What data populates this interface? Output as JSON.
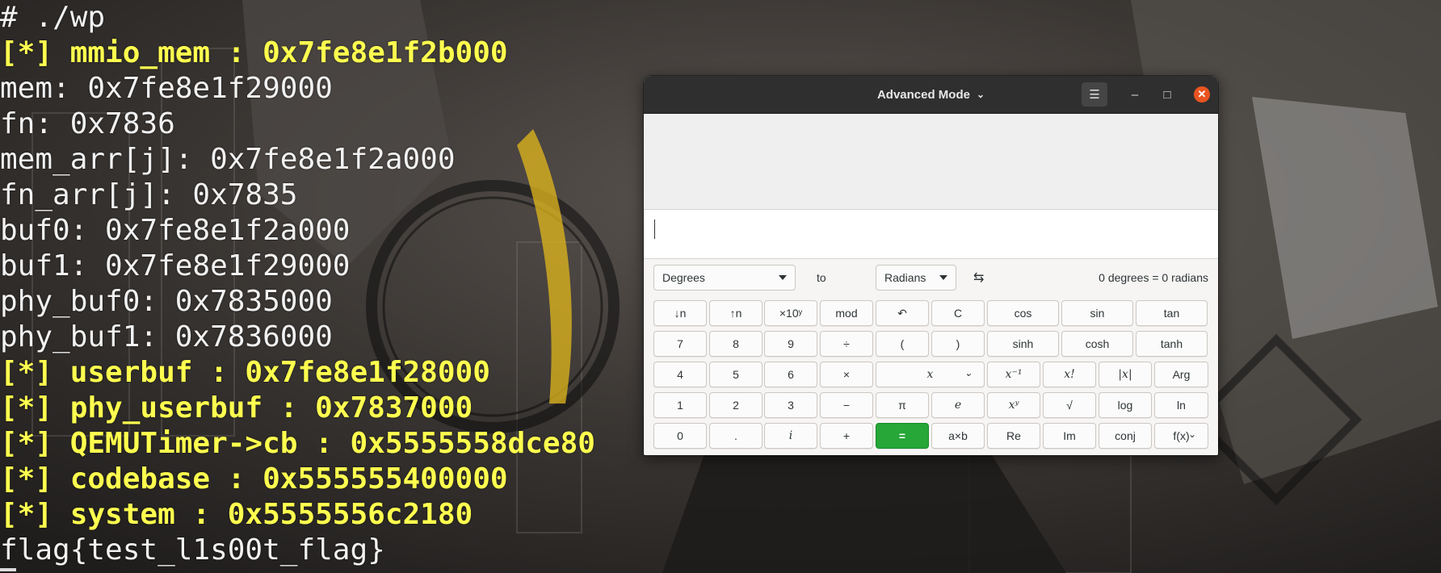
{
  "terminal": {
    "lines": [
      {
        "text": "# ./wp",
        "highlight": false
      },
      {
        "text": "[*] mmio_mem : 0x7fe8e1f2b000",
        "highlight": true
      },
      {
        "text": "mem: 0x7fe8e1f29000",
        "highlight": false
      },
      {
        "text": "fn: 0x7836",
        "highlight": false
      },
      {
        "text": "mem_arr[j]: 0x7fe8e1f2a000",
        "highlight": false
      },
      {
        "text": "fn_arr[j]: 0x7835",
        "highlight": false
      },
      {
        "text": "buf0: 0x7fe8e1f2a000",
        "highlight": false
      },
      {
        "text": "buf1: 0x7fe8e1f29000",
        "highlight": false
      },
      {
        "text": "phy_buf0: 0x7835000",
        "highlight": false
      },
      {
        "text": "phy_buf1: 0x7836000",
        "highlight": false
      },
      {
        "text": "[*] userbuf : 0x7fe8e1f28000",
        "highlight": true
      },
      {
        "text": "[*] phy_userbuf : 0x7837000",
        "highlight": true
      },
      {
        "text": "[*] QEMUTimer->cb : 0x5555558dce80",
        "highlight": true
      },
      {
        "text": "[*] codebase : 0x555555400000",
        "highlight": true
      },
      {
        "text": "[*] system : 0x5555556c2180",
        "highlight": true
      },
      {
        "text": "flag{test_l1s00t_flag}",
        "highlight": false
      }
    ],
    "text_color": "#f2f2f2",
    "highlight_color": "#ffff4f"
  },
  "calculator": {
    "title": "Advanced Mode",
    "title_chevron": "⌄",
    "menu_icon": "☰",
    "minimize_icon": "–",
    "maximize_icon": "□",
    "close_icon": "✕",
    "conversion": {
      "from_unit": "Degrees",
      "to_label": "to",
      "to_unit": "Radians",
      "swap_icon": "⇆",
      "result": "0 degrees  =  0 radians"
    },
    "keys": [
      [
        "↓n",
        "↑n",
        "×10ʸ",
        "mod",
        "↶",
        "C",
        "cos",
        "sin",
        "tan"
      ],
      [
        "7",
        "8",
        "9",
        "÷",
        "(",
        ")",
        "sinh",
        "cosh",
        "tanh"
      ],
      [
        "4",
        "5",
        "6",
        "×",
        "x",
        "x⁻¹",
        "x!",
        "|x|",
        "Arg"
      ],
      [
        "1",
        "2",
        "3",
        "−",
        "π",
        "e",
        "xʸ",
        "√",
        "log",
        "ln"
      ],
      [
        "0",
        ".",
        "i",
        "+",
        "=",
        "a×b",
        "Re",
        "Im",
        "conj",
        "f(x)"
      ]
    ],
    "accent_color": "#26a737",
    "close_color": "#e95420"
  }
}
